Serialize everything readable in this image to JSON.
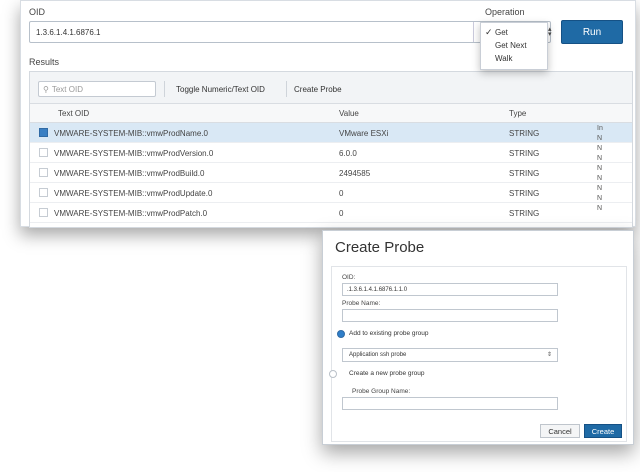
{
  "oid": {
    "label": "OID",
    "value": "1.3.6.1.4.1.6876.1"
  },
  "operation": {
    "label": "Operation",
    "options": [
      "Get",
      "Get Next",
      "Walk"
    ],
    "selected": "Get"
  },
  "run_label": "Run",
  "results": {
    "label": "Results",
    "filter_placeholder": "Text OID",
    "toggle_label": "Toggle Numeric/Text OID",
    "create_probe_label": "Create Probe",
    "columns": [
      "Text OID",
      "Value",
      "Type"
    ],
    "rows": [
      {
        "oid": "VMWARE-SYSTEM-MIB::vmwProdName.0",
        "value": "VMware ESXi",
        "type": "STRING",
        "selected": true
      },
      {
        "oid": "VMWARE-SYSTEM-MIB::vmwProdVersion.0",
        "value": "6.0.0",
        "type": "STRING",
        "selected": false
      },
      {
        "oid": "VMWARE-SYSTEM-MIB::vmwProdBuild.0",
        "value": "2494585",
        "type": "STRING",
        "selected": false
      },
      {
        "oid": "VMWARE-SYSTEM-MIB::vmwProdUpdate.0",
        "value": "0",
        "type": "STRING",
        "selected": false
      },
      {
        "oid": "VMWARE-SYSTEM-MIB::vmwProdPatch.0",
        "value": "0",
        "type": "STRING",
        "selected": false
      }
    ],
    "right_edge_letters": [
      "In",
      "N",
      "N",
      "N",
      "N",
      "N",
      "N",
      "N",
      "N"
    ]
  },
  "dialog": {
    "title": "Create Probe",
    "oid_label": "OID:",
    "oid_value": ".1.3.6.1.4.1.6876.1.1.0",
    "probe_name_label": "Probe Name:",
    "probe_name_value": "",
    "add_existing_label": "Add to existing probe group",
    "existing_group_value": "Application ssh probe",
    "create_new_label": "Create a new probe group",
    "group_name_label": "Probe Group Name:",
    "group_name_value": "",
    "cancel_label": "Cancel",
    "create_label": "Create"
  },
  "colors": {
    "accent": "#1f6aa5",
    "selected_row": "#d9e8f5"
  }
}
